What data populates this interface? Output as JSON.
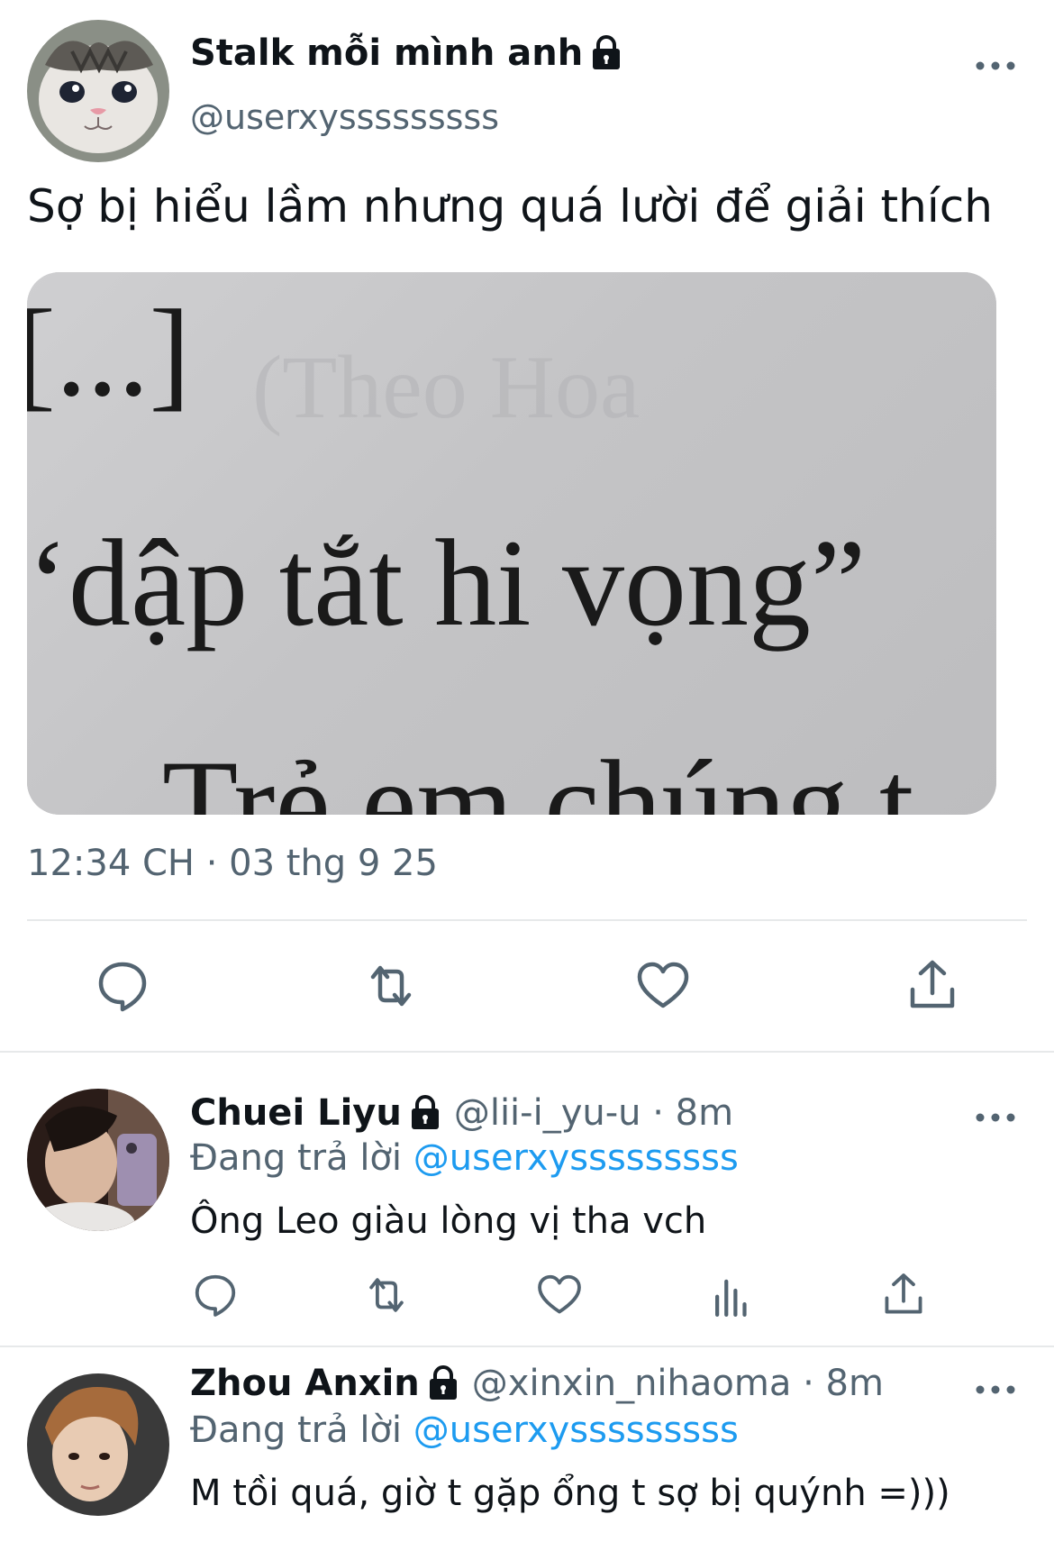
{
  "main_tweet": {
    "display_name": "Stalk mỗi mình anh",
    "handle": "@userxysssssssss",
    "text": "Sợ bị hiểu lầm nhưng quá lười để giải thích",
    "media_text": {
      "line1": "[...]",
      "line2": "‘dập tắt hi vọng”",
      "line3": "Trẻ em chúng t",
      "ghost": "(Theo Hoa"
    },
    "timestamp": "12:34 CH · 03 thg 9 25",
    "actions": [
      "reply-icon",
      "retweet-icon",
      "like-icon",
      "share-icon"
    ]
  },
  "replies": [
    {
      "display_name": "Chuei Liyu",
      "handle_time": "@lii-i_yu-u · 8m",
      "replying_prefix": "Đang trả lời",
      "replying_to": "@userxysssssssss",
      "text": "Ông Leo giàu lòng vị tha vch",
      "actions": [
        "reply-icon",
        "retweet-icon",
        "like-icon",
        "views-icon",
        "share-icon"
      ]
    },
    {
      "display_name": "Zhou Anxin",
      "handle_time": "@xinxin_nihaoma · 8m",
      "replying_prefix": "Đang trả lời",
      "replying_to": "@userxysssssssss",
      "text": "M tồi quá, giờ t gặp ổng t sợ bị quýnh =)))"
    }
  ],
  "colors": {
    "text_primary": "#0f1419",
    "text_secondary": "#536471",
    "link": "#1d9bf0",
    "divider": "#e7e9ea"
  }
}
